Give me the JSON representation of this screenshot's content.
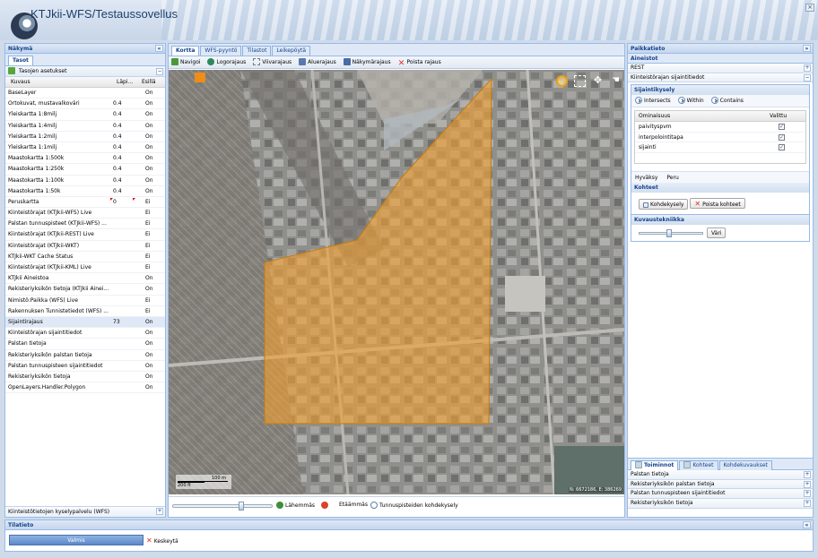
{
  "app": {
    "title": "KTJkii-WFS/Testaussovellus"
  },
  "left": {
    "title": "Näkymä",
    "collapse": "«",
    "tab": "Tasot",
    "group_title": "Tasojen asetukset",
    "columns": [
      "Kuvaus",
      "Läpi...",
      "Esillä"
    ],
    "rows": [
      {
        "name": "BaseLayer",
        "opacity": "",
        "visible": "On",
        "tag": ""
      },
      {
        "name": "Ortokuvat, mustavalkoväri",
        "opacity": "0.4",
        "visible": "On",
        "tag": ""
      },
      {
        "name": "Yleiskartta 1:8milj",
        "opacity": "0.4",
        "visible": "On",
        "tag": ""
      },
      {
        "name": "Yleiskartta 1:4milj",
        "opacity": "0.4",
        "visible": "On",
        "tag": ""
      },
      {
        "name": "Yleiskartta 1:2milj",
        "opacity": "0.4",
        "visible": "On",
        "tag": ""
      },
      {
        "name": "Yleiskartta 1:1milj",
        "opacity": "0.4",
        "visible": "On",
        "tag": ""
      },
      {
        "name": "Maastokartta 1:500k",
        "opacity": "0.4",
        "visible": "On",
        "tag": ""
      },
      {
        "name": "Maastokartta 1:250k",
        "opacity": "0.4",
        "visible": "On",
        "tag": ""
      },
      {
        "name": "Maastokartta 1:100k",
        "opacity": "0.4",
        "visible": "On",
        "tag": ""
      },
      {
        "name": "Maastokartta 1:50k",
        "opacity": "0.4",
        "visible": "On",
        "tag": ""
      },
      {
        "name": "Peruskartta",
        "opacity": "0",
        "visible": "Ei",
        "tag": "edited"
      },
      {
        "name": "Kiinteistörajat (KTJkii-WFS) Live",
        "opacity": "",
        "visible": "Ei",
        "tag": ""
      },
      {
        "name": "Palstan tunnuspisteet (KTJkii-WFS) ...",
        "opacity": "",
        "visible": "Ei",
        "tag": ""
      },
      {
        "name": "Kiinteistörajat (KTJkii-REST) Live",
        "opacity": "",
        "visible": "Ei",
        "tag": ""
      },
      {
        "name": "Kiinteistörajat (KTJkii-WKT)",
        "opacity": "",
        "visible": "Ei",
        "tag": ""
      },
      {
        "name": "KTJkii-WKT Cache Status",
        "opacity": "",
        "visible": "Ei",
        "tag": ""
      },
      {
        "name": "Kiinteistörajat (KTJkii-KML) Live",
        "opacity": "",
        "visible": "Ei",
        "tag": ""
      },
      {
        "name": "KTJkii Aineistoa",
        "opacity": "",
        "visible": "On",
        "tag": ""
      },
      {
        "name": "Rekisteriyksikön tietoja (KTJkii Ainei...",
        "opacity": "",
        "visible": "On",
        "tag": ""
      },
      {
        "name": "Nimistö:Paikka (WFS) Live",
        "opacity": "",
        "visible": "Ei",
        "tag": ""
      },
      {
        "name": "Rakennuksen Tunnistetiedot (WFS) ...",
        "opacity": "",
        "visible": "Ei",
        "tag": ""
      },
      {
        "name": "Sijaintirajaus",
        "opacity": "73",
        "visible": "On",
        "tag": "sel"
      },
      {
        "name": "Kiinteistörajan sijaintitiedot",
        "opacity": "",
        "visible": "On",
        "tag": ""
      },
      {
        "name": "Palstan tietoja",
        "opacity": "",
        "visible": "On",
        "tag": ""
      },
      {
        "name": "Rekisteriyksikön palstan tietoja",
        "opacity": "",
        "visible": "On",
        "tag": ""
      },
      {
        "name": "Palstan tunnuspisteen sijaintitiedot",
        "opacity": "",
        "visible": "On",
        "tag": ""
      },
      {
        "name": "Rekisteriyksikön tietoja",
        "opacity": "",
        "visible": "On",
        "tag": ""
      },
      {
        "name": "OpenLayers.Handler.Polygon",
        "opacity": "",
        "visible": "On",
        "tag": ""
      }
    ],
    "footer": "Kiinteistötietojen kyselypalvelu (WFS)"
  },
  "center": {
    "tabs": [
      "Kortta",
      "WFS-pyyntö",
      "Tilastot",
      "Leikepöytä"
    ],
    "toolbar": [
      "Navigoi",
      "Logorajaus",
      "Viivarajaus",
      "Aluerajaus",
      "Näkymärajaus",
      "Poista rajaus"
    ],
    "scale_m": "100 m",
    "scale_ft": "200 ft",
    "coords": "N: 6672186, E: 386269",
    "zoom_in": "Lähemmäs",
    "zoom_out": "Etäämmäs",
    "query": "Tunnuspisteiden kohdekysely",
    "zoom_level": 0.7
  },
  "right": {
    "title": "Paikkatieto",
    "collapse": "»",
    "sec1": "Aineistot",
    "rest": "REST",
    "kiint": "Kiinteistörajan sijaintitiedot",
    "sij_title": "Sijaintikysely",
    "radio": [
      "Intersects",
      "Within",
      "Contains"
    ],
    "grid_cols": [
      "Ominaisuus",
      "Valittu"
    ],
    "grid_rows": [
      {
        "name": "paivityspvm",
        "checked": true
      },
      {
        "name": "interpolointitapa",
        "checked": true
      },
      {
        "name": "sijainti",
        "checked": true
      }
    ],
    "accept": "Hyväksy",
    "cancel": "Peru",
    "kohteet_title": "Kohteet",
    "kohdekysely": "Kohdekysely",
    "poista_kohteet": "Poista kohteet",
    "kuvaus_title": "Kuvaustekniikka",
    "color_btn": "Väri",
    "slider_level": 0.45,
    "bottom_tabs": [
      "Toiminnot",
      "Kohteet",
      "Kohdekuvaukset"
    ],
    "acc": [
      "Palstan tietoja",
      "Rekisteriyksikön palstan tietoja",
      "Palstan tunnuspisteen sijaintitiedot",
      "Rekisteriyksikön tietoja"
    ]
  },
  "status": {
    "title": "Tilatieto",
    "collapse": "«",
    "progress": "Valmis",
    "cancel": "Keskeytä"
  },
  "colors": {
    "polygon": "#f0a030",
    "accent": "#15428b",
    "border": "#99bbe8"
  }
}
